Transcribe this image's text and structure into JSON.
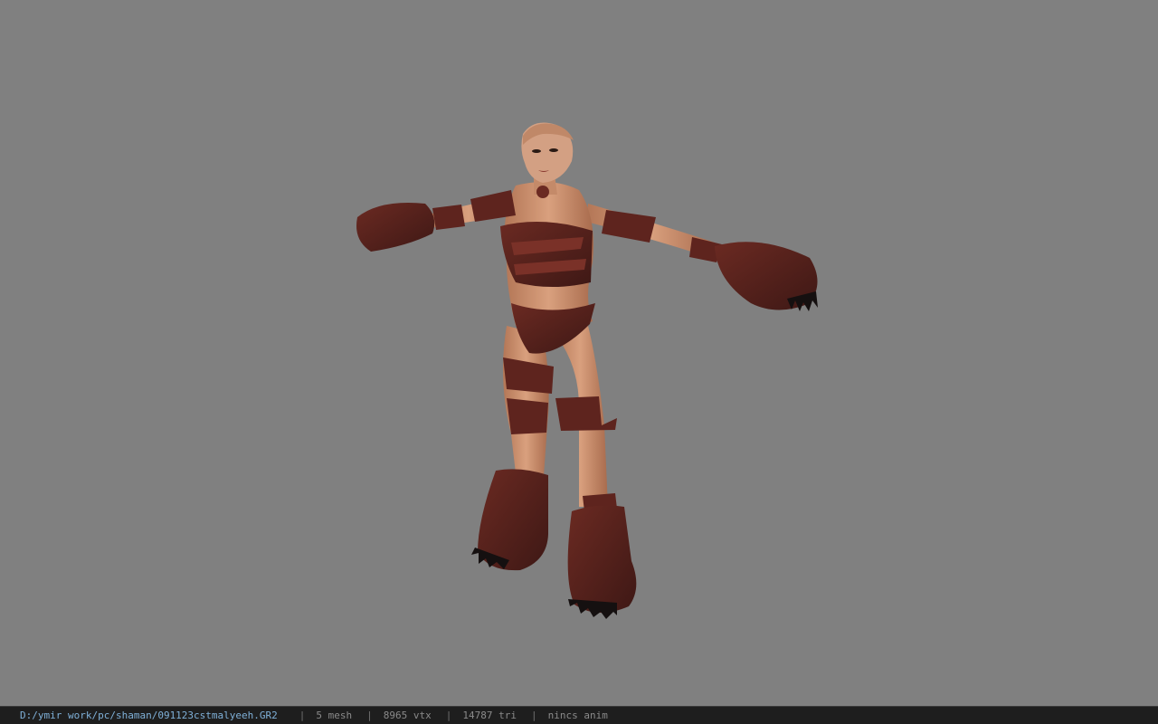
{
  "viewport": {
    "background_color": "#808080",
    "model": {
      "subject": "character-model",
      "skin_color": "#c98f6e",
      "wrap_color": "#5a2620",
      "claw_color": "#151010"
    }
  },
  "status_bar": {
    "file_path": "D:/ymir work/pc/shaman/091123cstmalyeeh.GR2",
    "separator": "|",
    "mesh_count": "5 mesh",
    "vertex_count": "8965 vtx",
    "triangle_count": "14787 tri",
    "animation": "nincs anim"
  }
}
